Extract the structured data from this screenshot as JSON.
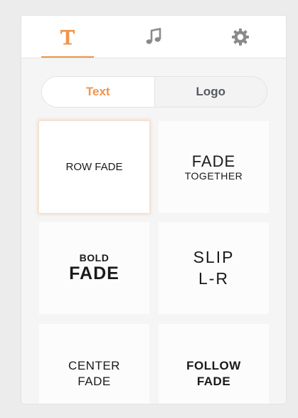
{
  "colors": {
    "accent": "#f0954a",
    "icon_gray": "#8a8a8a"
  },
  "tabs": [
    {
      "icon": "text-icon",
      "active": true
    },
    {
      "icon": "music-icon",
      "active": false
    },
    {
      "icon": "gear-icon",
      "active": false
    }
  ],
  "segment": {
    "text_label": "Text",
    "logo_label": "Logo",
    "selected": "Text"
  },
  "animations": [
    {
      "lines": [
        "ROW FADE"
      ],
      "selected": true
    },
    {
      "lines": [
        "FADE",
        "TOGETHER"
      ]
    },
    {
      "lines": [
        "BOLD",
        "FADE"
      ]
    },
    {
      "lines": [
        "SLIP",
        "L-R"
      ]
    },
    {
      "lines": [
        "CENTER",
        "FADE"
      ]
    },
    {
      "lines": [
        "FOLLOW",
        "FADE"
      ]
    }
  ]
}
